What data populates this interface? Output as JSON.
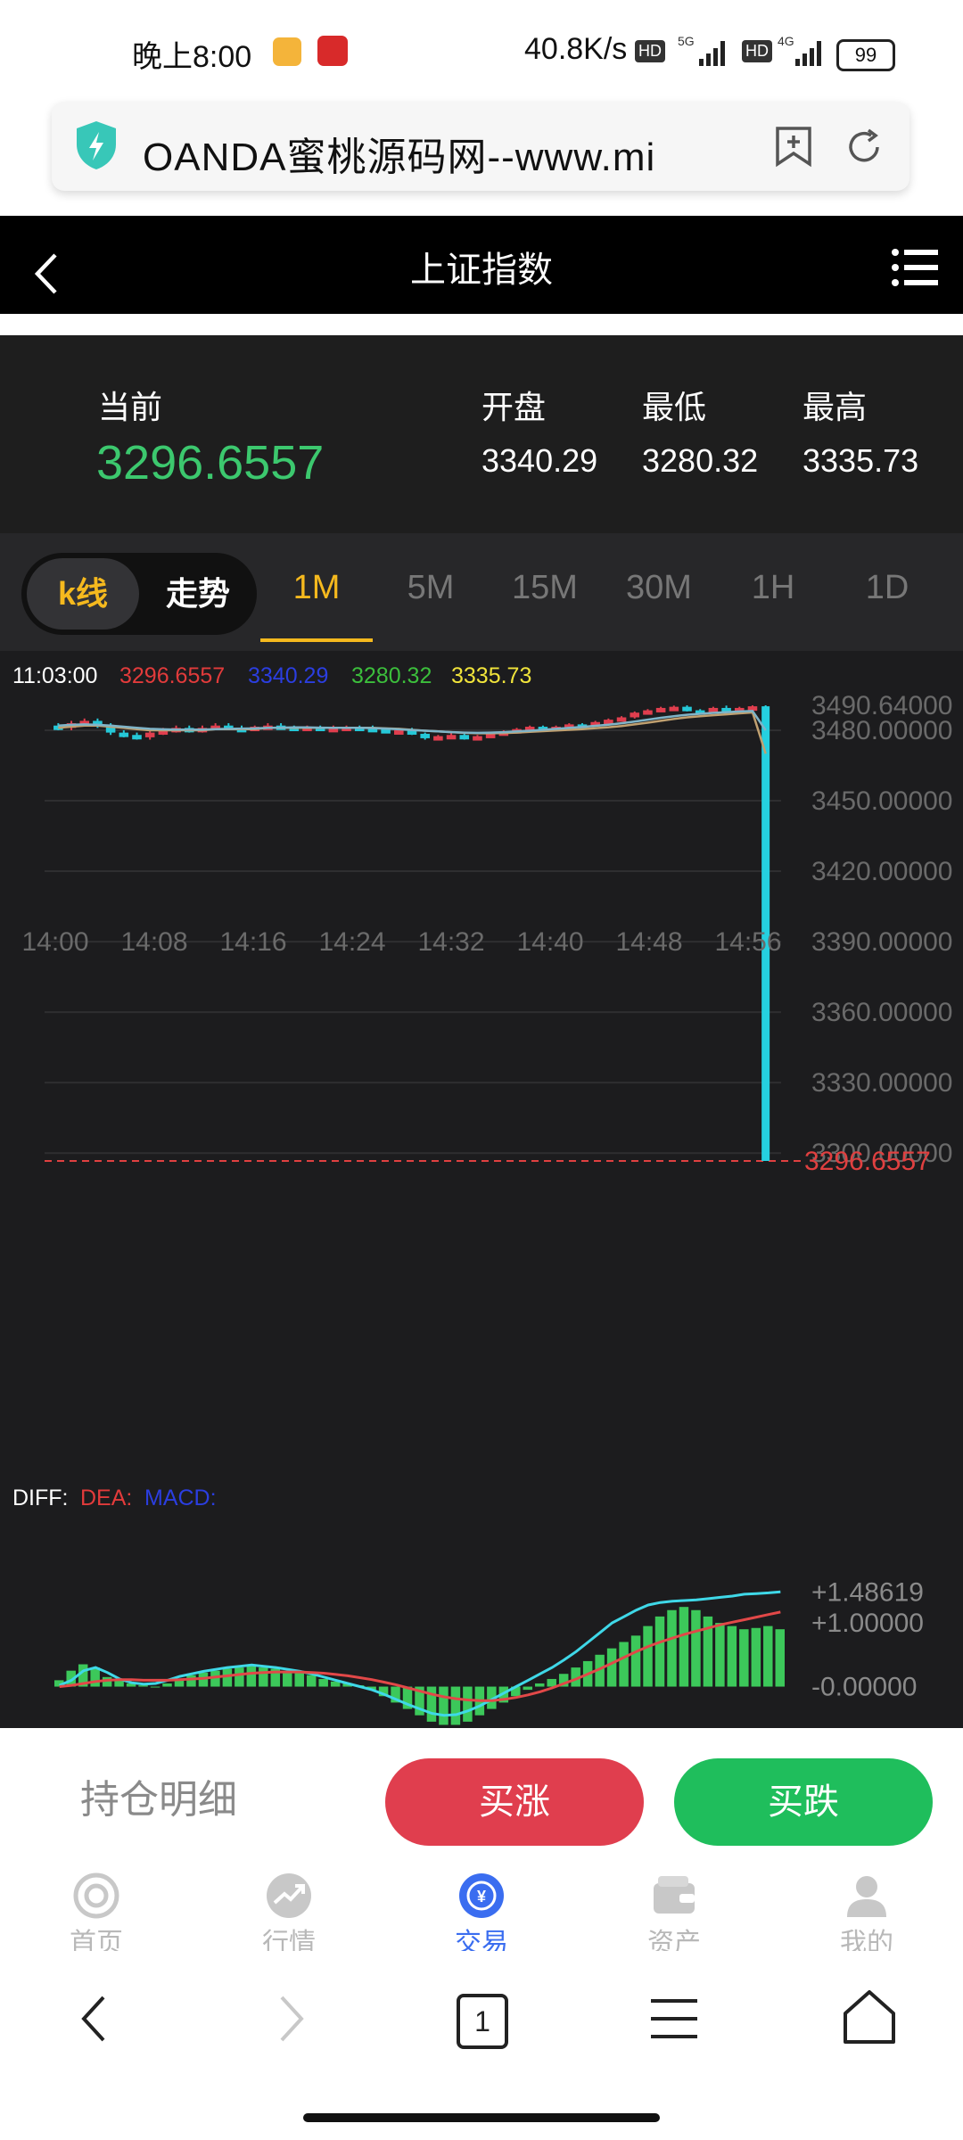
{
  "status_bar": {
    "time": "晚上8:00",
    "network_speed": "40.8K/s",
    "hd_1": "HD",
    "net_1": "5G",
    "hd_2": "HD",
    "net_2": "4G",
    "battery": "99"
  },
  "browser": {
    "url_text": "OANDA蜜桃源码网--www.mi"
  },
  "header": {
    "title": "上证指数"
  },
  "quote": {
    "current_label": "当前",
    "current_value": "3296.6557",
    "open_label": "开盘",
    "open_value": "3340.29",
    "low_label": "最低",
    "low_value": "3280.32",
    "high_label": "最高",
    "high_value": "3335.73"
  },
  "chart_tabs": {
    "kline": "k线",
    "trend": "走势",
    "intervals": [
      "1M",
      "5M",
      "15M",
      "30M",
      "1H",
      "1D"
    ],
    "active_interval": "1M"
  },
  "chart_data": [
    {
      "type": "candlestick",
      "info_time": "11:03:00",
      "info_values": [
        "3296.6557",
        "3340.29",
        "3280.32",
        "3335.73"
      ],
      "x_ticks": [
        "14:00",
        "14:08",
        "14:16",
        "14:24",
        "14:32",
        "14:40",
        "14:48",
        "14:56"
      ],
      "y_ticks": [
        "3490.64000",
        "3480.00000",
        "3450.00000",
        "3420.00000",
        "3390.00000",
        "3360.00000",
        "3330.00000",
        "3300.00000"
      ],
      "ylim": [
        3296.6557,
        3492
      ],
      "current_price_label": "3296.6557",
      "current_price": 3296.6557,
      "candles": [
        [
          3482,
          3483,
          3480,
          3481
        ],
        [
          3481,
          3484,
          3480,
          3483
        ],
        [
          3483,
          3485,
          3482,
          3484
        ],
        [
          3484,
          3485,
          3481,
          3482
        ],
        [
          3482,
          3483,
          3478,
          3479
        ],
        [
          3479,
          3480,
          3477,
          3478
        ],
        [
          3478,
          3479,
          3476,
          3477
        ],
        [
          3477,
          3480,
          3476,
          3479
        ],
        [
          3479,
          3481,
          3478,
          3480
        ],
        [
          3480,
          3482,
          3479,
          3481
        ],
        [
          3481,
          3482,
          3479,
          3480
        ],
        [
          3480,
          3482,
          3479,
          3481
        ],
        [
          3481,
          3483,
          3480,
          3482
        ],
        [
          3482,
          3483,
          3480,
          3481
        ],
        [
          3481,
          3482,
          3480,
          3480.5
        ],
        [
          3480.5,
          3482,
          3480,
          3481.5
        ],
        [
          3481.5,
          3483,
          3481,
          3482
        ],
        [
          3482,
          3483,
          3481,
          3481.5
        ],
        [
          3481.5,
          3482,
          3480,
          3481
        ],
        [
          3481,
          3482,
          3480,
          3481.5
        ],
        [
          3481.5,
          3482,
          3480,
          3480.5
        ],
        [
          3480.5,
          3482,
          3480,
          3481
        ],
        [
          3481,
          3482,
          3480,
          3481.5
        ],
        [
          3481.5,
          3482,
          3480.5,
          3481
        ],
        [
          3481,
          3482,
          3480,
          3480.5
        ],
        [
          3480.5,
          3481,
          3479,
          3479.5
        ],
        [
          3479.5,
          3481,
          3479,
          3480
        ],
        [
          3480,
          3481,
          3478,
          3478.5
        ],
        [
          3478.5,
          3479,
          3476,
          3477
        ],
        [
          3477,
          3478,
          3476,
          3477.5
        ],
        [
          3477.5,
          3479,
          3477,
          3478
        ],
        [
          3478,
          3479,
          3476,
          3476.5
        ],
        [
          3476.5,
          3478,
          3476,
          3477.5
        ],
        [
          3477.5,
          3479,
          3477,
          3478.5
        ],
        [
          3478.5,
          3480,
          3478,
          3479.5
        ],
        [
          3479.5,
          3481,
          3479,
          3480.5
        ],
        [
          3480.5,
          3482,
          3480,
          3481.5
        ],
        [
          3481.5,
          3482,
          3480.5,
          3481
        ],
        [
          3481,
          3482,
          3480,
          3481.5
        ],
        [
          3481.5,
          3483,
          3481,
          3482.5
        ],
        [
          3482.5,
          3483,
          3481.5,
          3482
        ],
        [
          3482,
          3484,
          3481.5,
          3483.5
        ],
        [
          3483.5,
          3485,
          3483,
          3484.5
        ],
        [
          3484.5,
          3486,
          3484,
          3485.5
        ],
        [
          3485.5,
          3488,
          3485,
          3487.5
        ],
        [
          3487.5,
          3489,
          3487,
          3488.5
        ],
        [
          3488.5,
          3490,
          3488,
          3489.5
        ],
        [
          3489.5,
          3490.5,
          3489,
          3490
        ],
        [
          3490,
          3490.6,
          3488,
          3488.5
        ],
        [
          3488.5,
          3489,
          3487.5,
          3488
        ],
        [
          3488,
          3490,
          3487.5,
          3489.5
        ],
        [
          3489.5,
          3490.5,
          3488,
          3488.5
        ],
        [
          3488.5,
          3490,
          3488,
          3489.5
        ],
        [
          3489.5,
          3490.6,
          3489,
          3490.2
        ],
        [
          3490.2,
          3490.6,
          3296.6557,
          3296.6557
        ]
      ],
      "ma_lines": [
        {
          "color": "#c0a070",
          "values": [
            3481,
            3481.5,
            3482,
            3482,
            3481.5,
            3481,
            3480.5,
            3480,
            3480,
            3480,
            3480,
            3480,
            3480.5,
            3480.5,
            3480.5,
            3480.5,
            3481,
            3481,
            3481,
            3481,
            3481,
            3481,
            3481,
            3481,
            3481,
            3480.8,
            3480.6,
            3480.2,
            3479.8,
            3479.5,
            3479.2,
            3478.9,
            3478.7,
            3478.7,
            3478.8,
            3479,
            3479.3,
            3479.6,
            3479.9,
            3480.2,
            3480.5,
            3480.9,
            3481.3,
            3481.8,
            3482.5,
            3483.2,
            3484,
            3484.8,
            3485.5,
            3486,
            3486.4,
            3486.8,
            3487.2,
            3487.6,
            3470
          ]
        },
        {
          "color": "#7fb4c8",
          "values": [
            3482,
            3482.3,
            3482.5,
            3482.3,
            3482,
            3481.5,
            3481,
            3480.6,
            3480.4,
            3480.3,
            3480.3,
            3480.3,
            3480.5,
            3480.6,
            3480.7,
            3480.8,
            3481,
            3481.1,
            3481.2,
            3481.2,
            3481.1,
            3481,
            3481,
            3481,
            3480.9,
            3480.7,
            3480.4,
            3480.1,
            3479.8,
            3479.5,
            3479.2,
            3479,
            3478.9,
            3479,
            3479.2,
            3479.5,
            3479.8,
            3480.2,
            3480.6,
            3481,
            3481.4,
            3481.9,
            3482.4,
            3483,
            3483.7,
            3484.5,
            3485.3,
            3486,
            3486.6,
            3487,
            3487.4,
            3487.7,
            3488,
            3488.2,
            3480
          ]
        }
      ]
    },
    {
      "type": "macd",
      "legend": [
        "DIFF:",
        "DEA:",
        "MACD:"
      ],
      "y_ticks": [
        "+1.48619",
        "+1.00000",
        "-0.00000"
      ],
      "ylim": [
        -0.65,
        1.7
      ],
      "hist": [
        0.1,
        0.25,
        0.35,
        0.3,
        0.15,
        0.1,
        0.05,
        0.02,
        0.0,
        0.05,
        0.12,
        0.18,
        0.22,
        0.25,
        0.28,
        0.3,
        0.32,
        0.3,
        0.28,
        0.25,
        0.22,
        0.18,
        0.12,
        0.08,
        0.05,
        0.02,
        -0.05,
        -0.15,
        -0.25,
        -0.35,
        -0.45,
        -0.55,
        -0.6,
        -0.6,
        -0.55,
        -0.45,
        -0.35,
        -0.25,
        -0.15,
        -0.05,
        0.05,
        0.12,
        0.2,
        0.3,
        0.4,
        0.5,
        0.6,
        0.7,
        0.8,
        0.95,
        1.1,
        1.2,
        1.25,
        1.2,
        1.1,
        1.0,
        0.95,
        0.9,
        0.92,
        0.95,
        0.9
      ],
      "diff": [
        0.02,
        0.1,
        0.25,
        0.3,
        0.22,
        0.12,
        0.06,
        0.04,
        0.05,
        0.1,
        0.16,
        0.2,
        0.24,
        0.27,
        0.3,
        0.32,
        0.34,
        0.32,
        0.3,
        0.27,
        0.24,
        0.2,
        0.15,
        0.1,
        0.05,
        0.0,
        -0.05,
        -0.12,
        -0.2,
        -0.28,
        -0.35,
        -0.42,
        -0.45,
        -0.44,
        -0.38,
        -0.3,
        -0.2,
        -0.1,
        0.0,
        0.1,
        0.2,
        0.3,
        0.42,
        0.55,
        0.7,
        0.85,
        1.0,
        1.1,
        1.2,
        1.28,
        1.32,
        1.34,
        1.35,
        1.36,
        1.38,
        1.4,
        1.42,
        1.45,
        1.46,
        1.47,
        1.486
      ],
      "dea": [
        0.0,
        0.02,
        0.05,
        0.08,
        0.1,
        0.11,
        0.11,
        0.1,
        0.1,
        0.1,
        0.11,
        0.12,
        0.13,
        0.15,
        0.17,
        0.19,
        0.21,
        0.22,
        0.23,
        0.23,
        0.23,
        0.22,
        0.21,
        0.19,
        0.17,
        0.14,
        0.11,
        0.07,
        0.03,
        -0.02,
        -0.07,
        -0.12,
        -0.16,
        -0.19,
        -0.21,
        -0.22,
        -0.22,
        -0.2,
        -0.17,
        -0.13,
        -0.08,
        -0.02,
        0.05,
        0.12,
        0.2,
        0.28,
        0.37,
        0.46,
        0.55,
        0.63,
        0.7,
        0.76,
        0.82,
        0.87,
        0.92,
        0.97,
        1.01,
        1.05,
        1.09,
        1.13,
        1.17
      ]
    }
  ],
  "actions": {
    "positions": "持仓明细",
    "buy_up": "买涨",
    "buy_down": "买跌"
  },
  "bottom_nav": {
    "items": [
      "首页",
      "行情",
      "交易",
      "资产",
      "我的"
    ],
    "active": "交易"
  },
  "browser_nav": {
    "tab_count": "1"
  },
  "colors": {
    "up": "#e03e4e",
    "down": "#1fbe5c",
    "accent": "#f5b91e",
    "current_price": "#3cc86e",
    "cyan": "#25d0e0",
    "active_nav": "#3a6df0"
  }
}
